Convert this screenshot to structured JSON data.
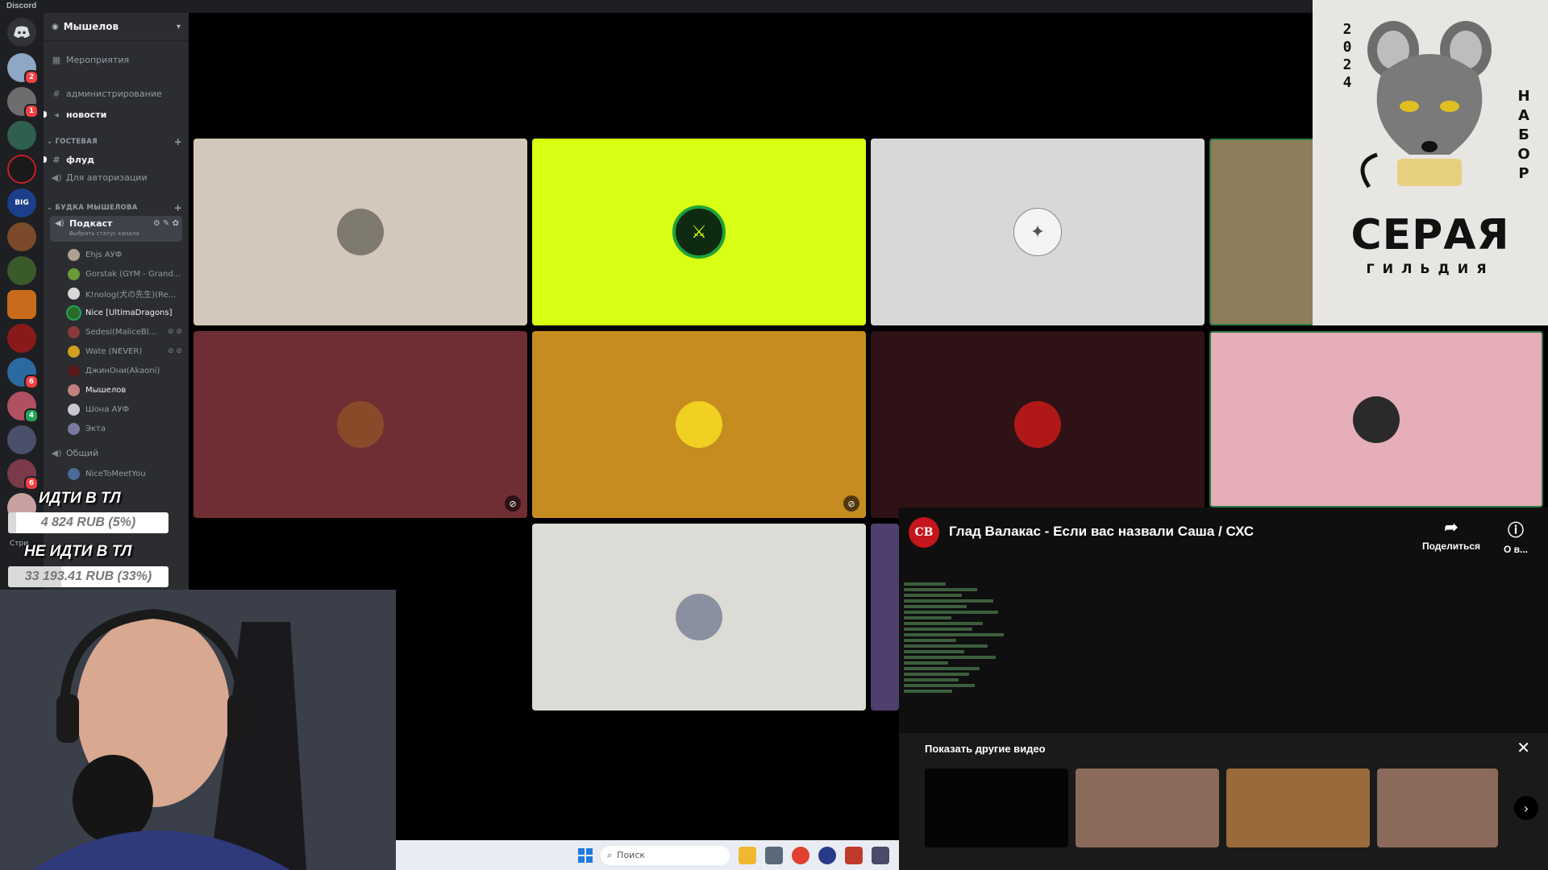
{
  "app": {
    "title": "Discord"
  },
  "servers": [
    {
      "badge": ""
    },
    {
      "badge": "2"
    },
    {
      "badge": "1"
    },
    {
      "badge": ""
    },
    {
      "badge": ""
    },
    {
      "badge": ""
    },
    {
      "badge": ""
    },
    {
      "badge": ""
    },
    {
      "badge": ""
    },
    {
      "badge": ""
    },
    {
      "badge": "6"
    },
    {
      "badge": "4"
    },
    {
      "badge": ""
    },
    {
      "badge": "6"
    }
  ],
  "sidebar": {
    "guild_name": "Мышелов",
    "events": "Мероприятия",
    "channels_top": [
      "администрирование",
      "новости"
    ],
    "categories": [
      "ГОСТЕВАЯ",
      "БУДКА МЫШЕЛОВА"
    ],
    "guest_channels": [
      "флуд",
      "Для авторизации"
    ],
    "voice_channel": "Подкаст",
    "voice_status": "Выбрать статус канала",
    "voice_users": [
      "Ehjs АУФ",
      "Gorstak (GYM - Grand...",
      "K!nolog(犬の先生)(Re...",
      "Nice [UltimaDragons]",
      "Sedesi(MaliceBl...",
      "Wate (NEVER)",
      "ДжинОни(Akaoni)",
      "Мышелов",
      "Шона АУФ",
      "Экта"
    ],
    "general_channel": "Общий",
    "general_users": [
      "NiceToMeetYou"
    ],
    "partial_label": "Стри"
  },
  "polls": [
    {
      "label": "ИДТИ В ТЛ",
      "amount": "4 824 RUB (5%)",
      "percent": 5
    },
    {
      "label": "НЕ ИДТИ В ТЛ",
      "amount": "33 193.41 RUB (33%)",
      "percent": 33
    }
  ],
  "poster": {
    "year": [
      "2",
      "0",
      "2",
      "4"
    ],
    "vertical_word": [
      "Н",
      "А",
      "Б",
      "О",
      "Р"
    ],
    "title": "СЕРАЯ",
    "subtitle": "ГИЛЬДИЯ"
  },
  "youtube": {
    "channel_logo": "СВ",
    "title": "Глад Валакас - Если вас назвали Саша / СХС",
    "share": "Поделиться",
    "info": "О в...",
    "more_videos": "Показать другие видео"
  },
  "taskbar": {
    "search_placeholder": "Поиск"
  },
  "colors": {
    "tile1": "#d3c8b9",
    "tile2": "#d8ff14",
    "tile3": "#d8d8d8",
    "tile4": "#8c7e5a",
    "tile5": "#6f2e33",
    "tile6": "#c68c1f",
    "tile7": "#2e1215",
    "tile8": "#e5aeb8",
    "tile9": "#dddbd5",
    "tile10": "#4f3f6f"
  }
}
